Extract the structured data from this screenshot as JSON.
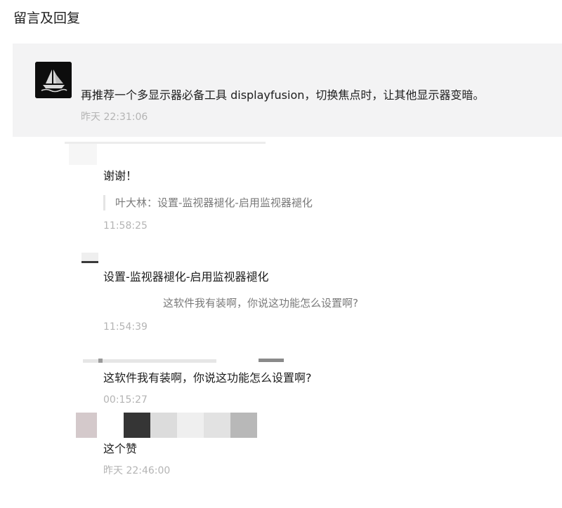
{
  "section": {
    "title": "留言及回复"
  },
  "main_comment": {
    "avatar_icon": "sailboat-logo-icon",
    "text": "再推荐一个多显示器必备工具 displayfusion，切换焦点时，让其他显示器变暗。",
    "time": "昨天 22:31:06"
  },
  "replies": [
    {
      "text": "谢谢！",
      "quote": "叶大林：设置-监视器褪化-启用监视器褪化",
      "time": "11:58:25"
    },
    {
      "text": "设置-监视器褪化-启用监视器褪化",
      "quote": "这软件我有装啊，你说这功能怎么设置啊?",
      "time": "11:54:39"
    },
    {
      "text": "这软件我有装啊，你说这功能怎么设置啊?",
      "time": "00:15:27"
    },
    {
      "text": "这个赞",
      "time": "昨天 22:46:00"
    }
  ],
  "colors": {
    "main_bg": "#f3f3f4",
    "time_text": "#b4b4b4",
    "quote_text": "#7a7a7a"
  }
}
